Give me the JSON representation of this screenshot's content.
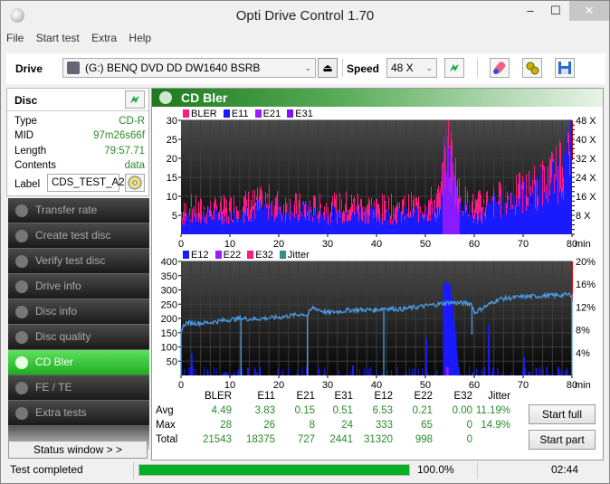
{
  "window": {
    "title": "Opti Drive Control 1.70",
    "min": "–",
    "max": "☐",
    "close": "✕"
  },
  "menu": [
    "File",
    "Start test",
    "Extra",
    "Help"
  ],
  "toolbar": {
    "drive_label": "Drive",
    "drive_value": "(G:)  BENQ DVD DD DW1640 BSRB",
    "eject": "⏏",
    "speed_label": "Speed",
    "speed_value": "48 X",
    "dropdown": "⌄"
  },
  "disc": {
    "heading": "Disc",
    "rows": [
      {
        "key": "Type",
        "value": "CD-R"
      },
      {
        "key": "MID",
        "value": "97m26s66f"
      },
      {
        "key": "Length",
        "value": "79:57.71"
      },
      {
        "key": "Contents",
        "value": "data"
      }
    ],
    "label_key": "Label",
    "label_value": "CDS_TEST_A2"
  },
  "nav": [
    {
      "label": "Transfer rate",
      "active": false
    },
    {
      "label": "Create test disc",
      "active": false
    },
    {
      "label": "Verify test disc",
      "active": false
    },
    {
      "label": "Drive info",
      "active": false
    },
    {
      "label": "Disc info",
      "active": false
    },
    {
      "label": "Disc quality",
      "active": false
    },
    {
      "label": "CD Bler",
      "active": true
    },
    {
      "label": "FE / TE",
      "active": false
    },
    {
      "label": "Extra tests",
      "active": false
    }
  ],
  "status_window_btn": "Status window > >",
  "panel": {
    "title": "CD Bler"
  },
  "chart_data": [
    {
      "type": "bar",
      "title": "BLER / E11 / E21 / E31",
      "legend": [
        {
          "name": "BLER",
          "color": "#ff1a80"
        },
        {
          "name": "E11",
          "color": "#1a1aff"
        },
        {
          "name": "E21",
          "color": "#a01aff"
        },
        {
          "name": "E31",
          "color": "#8010ff"
        }
      ],
      "xlabel": "min",
      "xlim": [
        0,
        80
      ],
      "xticks": [
        0,
        10,
        20,
        30,
        40,
        50,
        60,
        70,
        80
      ],
      "ylim": [
        0,
        30
      ],
      "yticks": [
        5,
        10,
        15,
        20,
        25,
        30
      ],
      "y2ticks": [
        "8 X",
        "16 X",
        "24 X",
        "32 X",
        "40 X",
        "48 X"
      ],
      "grid": true,
      "profile": {
        "x": [
          0,
          2,
          5,
          10,
          13,
          18,
          20,
          25,
          30,
          35,
          40,
          45,
          50,
          53,
          54,
          55,
          56,
          57,
          58,
          60,
          63,
          65,
          70,
          75,
          78,
          80
        ],
        "e11": [
          4,
          5,
          5,
          5,
          6,
          7,
          6,
          6,
          5,
          6,
          5,
          5,
          6,
          6,
          22,
          18,
          12,
          8,
          8,
          4,
          7,
          8,
          10,
          13,
          17,
          22
        ],
        "bler": [
          7,
          9,
          8,
          9,
          10,
          11,
          10,
          9,
          9,
          10,
          9,
          9,
          10,
          12,
          27,
          26,
          20,
          12,
          11,
          9,
          12,
          12,
          14,
          18,
          22,
          26
        ]
      }
    },
    {
      "type": "bar",
      "title": "E12 / E22 / E32 / Jitter",
      "legend": [
        {
          "name": "E12",
          "color": "#1a1aff"
        },
        {
          "name": "E22",
          "color": "#a01aff"
        },
        {
          "name": "E32",
          "color": "#ff1a80"
        },
        {
          "name": "Jitter",
          "color": "#3a8a8a"
        }
      ],
      "xlabel": "min",
      "xlim": [
        0,
        80
      ],
      "xticks": [
        0,
        10,
        20,
        30,
        40,
        50,
        60,
        70,
        80
      ],
      "ylim": [
        0,
        400
      ],
      "yticks": [
        50,
        100,
        150,
        200,
        250,
        300,
        350,
        400
      ],
      "y2lim": [
        0,
        20
      ],
      "y2ticks": [
        "4%",
        "8%",
        "12%",
        "16%",
        "20%"
      ],
      "grid": true,
      "e12_peaks": [
        [
          2,
          78
        ],
        [
          16,
          25
        ],
        [
          35,
          35
        ],
        [
          50,
          130
        ],
        [
          54,
          333
        ],
        [
          55,
          300
        ],
        [
          56,
          150
        ],
        [
          62.8,
          180
        ],
        [
          70,
          65
        ],
        [
          77,
          30
        ]
      ],
      "jitter": {
        "x": [
          0,
          1,
          5,
          10,
          12.3,
          15,
          20,
          25,
          25.8,
          27,
          30,
          35,
          40,
          41.5,
          45,
          50,
          55,
          59.5,
          60,
          65,
          70,
          75,
          80
        ],
        "y_percent": [
          8.0,
          9.2,
          9.2,
          9.8,
          10.0,
          9.9,
          10.2,
          10.8,
          10.5,
          11.9,
          11.0,
          11.5,
          11.5,
          11.8,
          11.6,
          12.2,
          12.8,
          12.6,
          11.0,
          13.4,
          13.8,
          14.0,
          14.2
        ]
      }
    }
  ],
  "stats": {
    "columns": [
      "BLER",
      "E11",
      "E21",
      "E31",
      "E12",
      "E22",
      "E32",
      "Jitter"
    ],
    "rows": [
      {
        "label": "Avg",
        "values": [
          "4.49",
          "3.83",
          "0.15",
          "0.51",
          "6.53",
          "0.21",
          "0.00",
          "11.19%"
        ]
      },
      {
        "label": "Max",
        "values": [
          "28",
          "26",
          "8",
          "24",
          "333",
          "65",
          "0",
          "14.9%"
        ]
      },
      {
        "label": "Total",
        "values": [
          "21543",
          "18375",
          "727",
          "2441",
          "31320",
          "998",
          "0",
          ""
        ]
      }
    ],
    "start_full": "Start full",
    "start_part": "Start part"
  },
  "statusbar": {
    "text": "Test completed",
    "progress_percent": 100,
    "progress_text": "100.0%",
    "time": "02:44"
  }
}
